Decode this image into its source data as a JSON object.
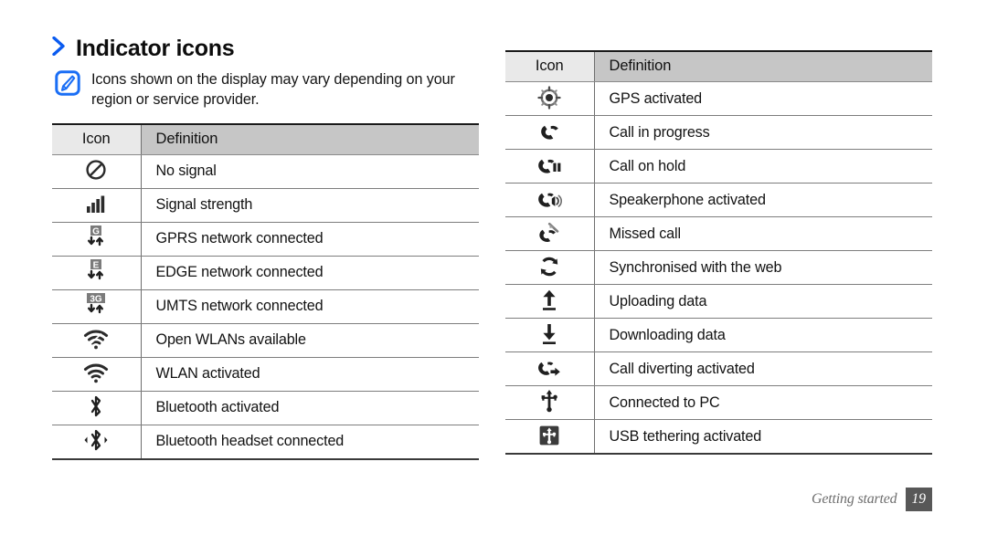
{
  "page": {
    "section_title": "Indicator icons",
    "chevron_icon": "chevron-right-icon",
    "title_color": "#0d0d0d",
    "accent_color": "#0a5bf0"
  },
  "note": {
    "icon": "note-pen-icon",
    "icon_color": "#1a6ef5",
    "text": "Icons shown on the display may vary depending on your region or service provider."
  },
  "tables": {
    "left": {
      "headers": {
        "icon": "Icon",
        "definition": "Definition"
      },
      "header_icon_bg": "#e9e9e9",
      "header_def_bg": "#c6c6c6",
      "rows": [
        {
          "icon_name": "no-signal-icon",
          "definition": "No signal"
        },
        {
          "icon_name": "signal-strength-icon",
          "definition": "Signal strength"
        },
        {
          "icon_name": "gprs-network-icon",
          "definition": "GPRS network connected"
        },
        {
          "icon_name": "edge-network-icon",
          "definition": "EDGE network connected"
        },
        {
          "icon_name": "umts-network-icon",
          "definition": "UMTS network connected"
        },
        {
          "icon_name": "open-wlan-icon",
          "definition": "Open WLANs available"
        },
        {
          "icon_name": "wlan-activated-icon",
          "definition": "WLAN activated"
        },
        {
          "icon_name": "bluetooth-icon",
          "definition": "Bluetooth activated"
        },
        {
          "icon_name": "bluetooth-headset-icon",
          "definition": "Bluetooth headset connected"
        }
      ]
    },
    "right": {
      "headers": {
        "icon": "Icon",
        "definition": "Definition"
      },
      "header_icon_bg": "#e9e9e9",
      "header_def_bg": "#c6c6c6",
      "rows": [
        {
          "icon_name": "gps-icon",
          "definition": "GPS activated"
        },
        {
          "icon_name": "call-in-progress-icon",
          "definition": "Call in progress"
        },
        {
          "icon_name": "call-on-hold-icon",
          "definition": "Call on hold"
        },
        {
          "icon_name": "speakerphone-icon",
          "definition": "Speakerphone activated"
        },
        {
          "icon_name": "missed-call-icon",
          "definition": "Missed call"
        },
        {
          "icon_name": "sync-web-icon",
          "definition": "Synchronised with the web"
        },
        {
          "icon_name": "upload-icon",
          "definition": "Uploading data"
        },
        {
          "icon_name": "download-icon",
          "definition": "Downloading data"
        },
        {
          "icon_name": "call-diverting-icon",
          "definition": "Call diverting activated"
        },
        {
          "icon_name": "usb-connected-icon",
          "definition": "Connected to PC"
        },
        {
          "icon_name": "usb-tethering-icon",
          "definition": "USB tethering activated"
        }
      ]
    }
  },
  "footer": {
    "label": "Getting started",
    "page_number": "19",
    "badge_color": "#585858",
    "label_color": "#6e6e6e"
  }
}
